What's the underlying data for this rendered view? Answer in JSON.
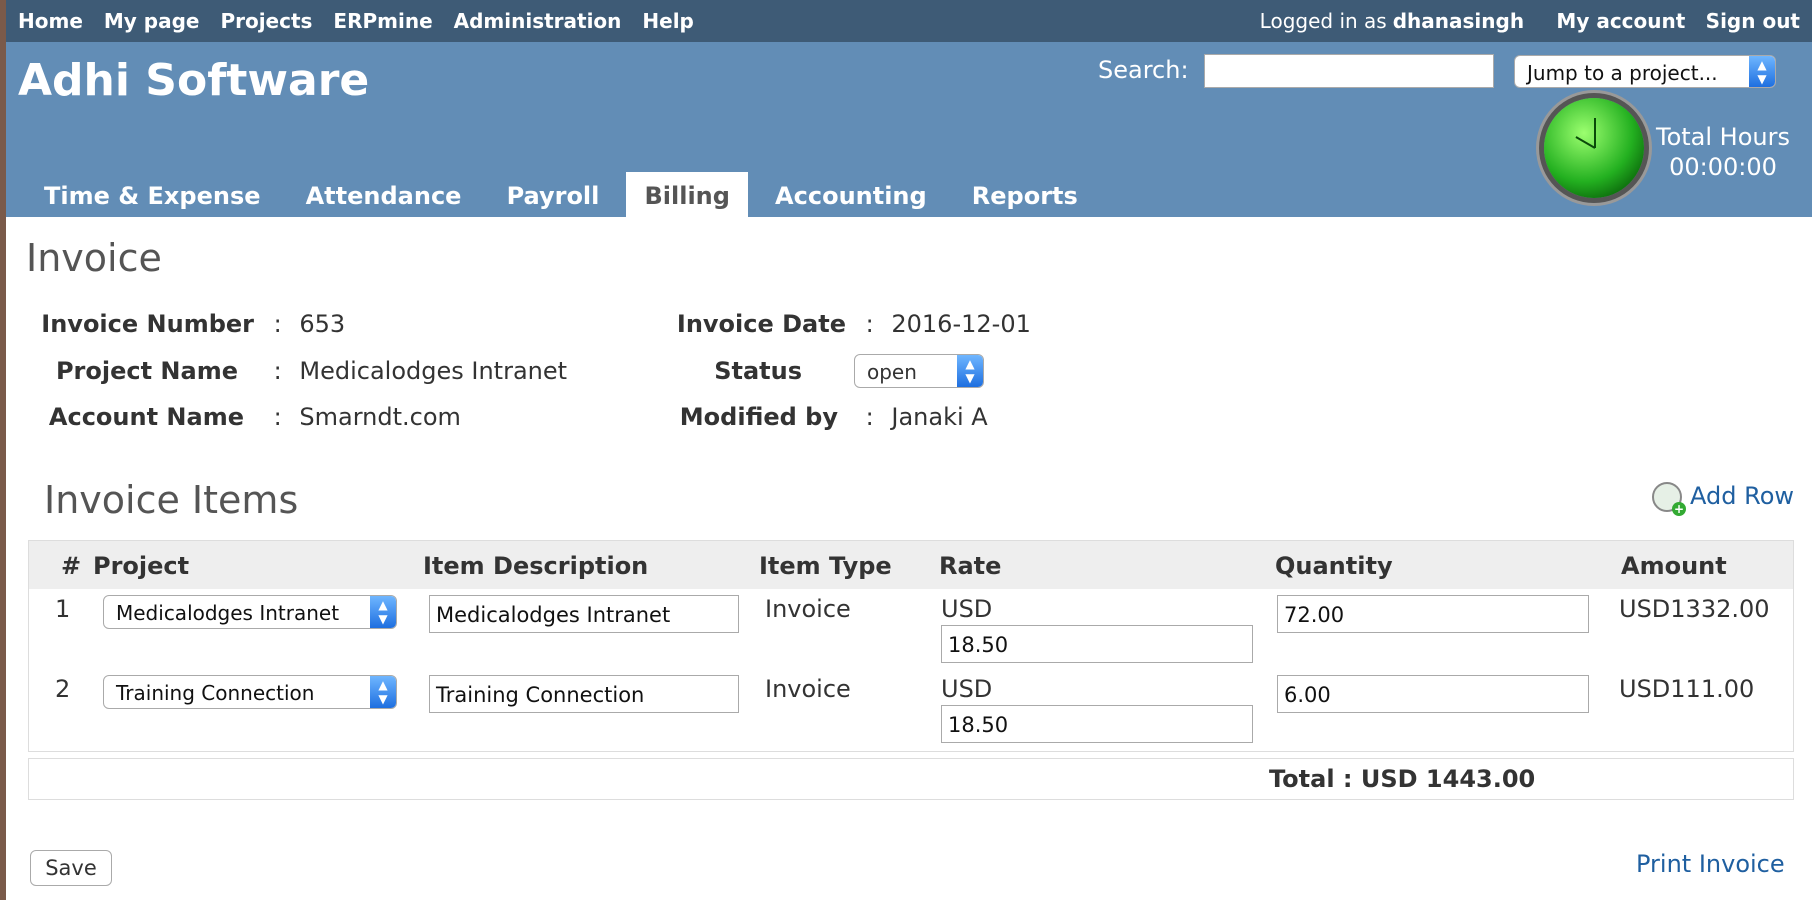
{
  "topnav": {
    "items": [
      "Home",
      "My page",
      "Projects",
      "ERPmine",
      "Administration",
      "Help"
    ],
    "logged_in_prefix": "Logged in as",
    "username": "dhanasingh",
    "my_account": "My account",
    "sign_out": "Sign out"
  },
  "header": {
    "brand": "Adhi Software",
    "search_label": "Search:",
    "jump": "Jump to a project...",
    "hours_label": "Total Hours",
    "hours_value": "00:00:00"
  },
  "tabs": [
    "Time & Expense",
    "Attendance",
    "Payroll",
    "Billing",
    "Accounting",
    "Reports"
  ],
  "active_tab": "Billing",
  "invoice": {
    "title": "Invoice",
    "number_label": "Invoice Number",
    "number": "653",
    "project_label": "Project Name",
    "project": "Medicalodges Intranet",
    "account_label": "Account Name",
    "account": "Smarndt.com",
    "date_label": "Invoice Date",
    "date": "2016-12-01",
    "status_label": "Status",
    "status": "open",
    "modified_label": "Modified by",
    "modified": "Janaki A",
    "separator": ":"
  },
  "items": {
    "title": "Invoice Items",
    "add_row": "Add Row",
    "headers": {
      "num": "#",
      "project": "Project",
      "desc": "Item Description",
      "type": "Item Type",
      "rate": "Rate",
      "qty": "Quantity",
      "amount": "Amount"
    },
    "rows": [
      {
        "num": "1",
        "project": "Medicalodges Intranet",
        "desc": "Medicalodges Intranet",
        "type": "Invoice",
        "currency": "USD",
        "rate": "18.50",
        "qty": "72.00",
        "amount": "USD1332.00"
      },
      {
        "num": "2",
        "project": "Training Connection",
        "desc": "Training Connection",
        "type": "Invoice",
        "currency": "USD",
        "rate": "18.50",
        "qty": "6.00",
        "amount": "USD111.00"
      }
    ],
    "total": "Total : USD 1443.00"
  },
  "actions": {
    "save": "Save",
    "print": "Print Invoice"
  }
}
